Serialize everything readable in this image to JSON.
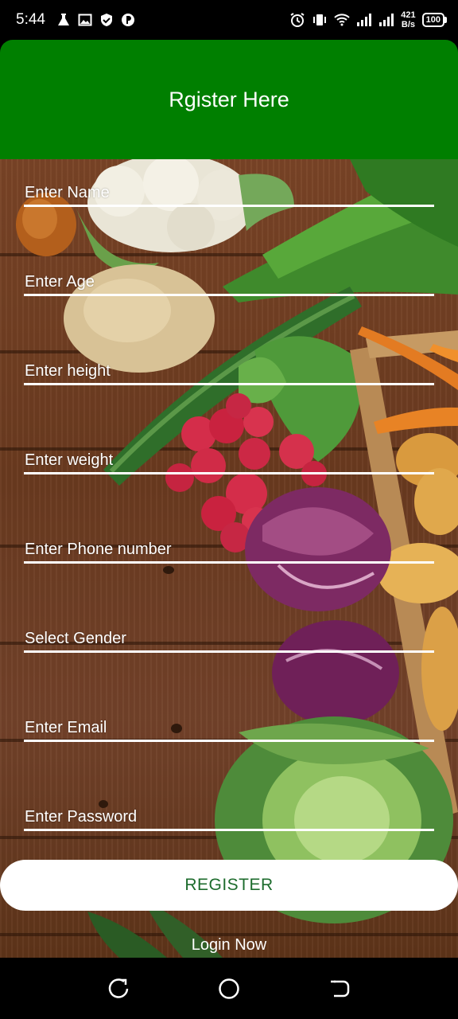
{
  "status_bar": {
    "time": "5:44",
    "net_speed_value": "421",
    "net_speed_unit": "B/s",
    "battery": "100",
    "left_icons": [
      "lab-flask-icon",
      "image-icon",
      "shield-icon",
      "p-icon"
    ],
    "right_icons": [
      "alarm-icon",
      "vibrate-icon",
      "wifi-icon",
      "signal-icon",
      "signal-icon"
    ]
  },
  "header": {
    "title": "Rgister Here"
  },
  "form": {
    "fields": [
      {
        "label": "Enter Name"
      },
      {
        "label": "Enter Age"
      },
      {
        "label": "Enter height"
      },
      {
        "label": "Enter weight"
      },
      {
        "label": "Enter Phone number"
      },
      {
        "label": "Select Gender"
      },
      {
        "label": "Enter Email"
      },
      {
        "label": "Enter Password"
      }
    ],
    "register_label": "REGISTER",
    "login_label": "Login Now"
  },
  "colors": {
    "header": "#007f00",
    "register_text": "#1c6b2c"
  },
  "nav_bar": {
    "icons": [
      "recent-apps-icon",
      "home-icon",
      "back-icon"
    ]
  }
}
